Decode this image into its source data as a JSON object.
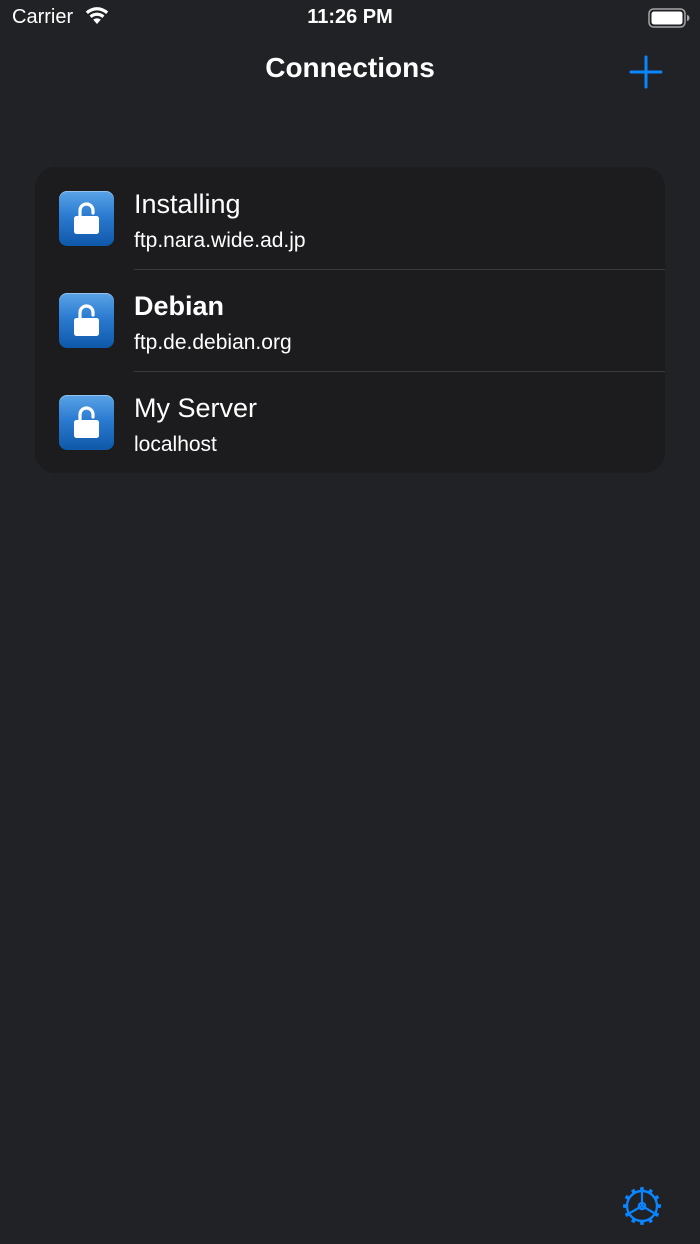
{
  "status_bar": {
    "carrier": "Carrier",
    "time": "11:26 PM",
    "wifi_icon": "wifi-icon",
    "battery_icon": "battery-full-icon"
  },
  "nav": {
    "title": "Connections",
    "add_icon": "plus-icon"
  },
  "connections": [
    {
      "name": "Installing",
      "host": "ftp.nara.wide.ad.jp",
      "bold": false,
      "icon": "unlocked-padlock-icon"
    },
    {
      "name": "Debian",
      "host": "ftp.de.debian.org",
      "bold": true,
      "icon": "unlocked-padlock-icon"
    },
    {
      "name": "My Server",
      "host": "localhost",
      "bold": false,
      "icon": "unlocked-padlock-icon"
    }
  ],
  "toolbar": {
    "settings_icon": "gear-icon"
  },
  "colors": {
    "background": "#212226",
    "card": "#1c1c1e",
    "accent": "#0a84ff",
    "separator": "#3a3a3d"
  }
}
